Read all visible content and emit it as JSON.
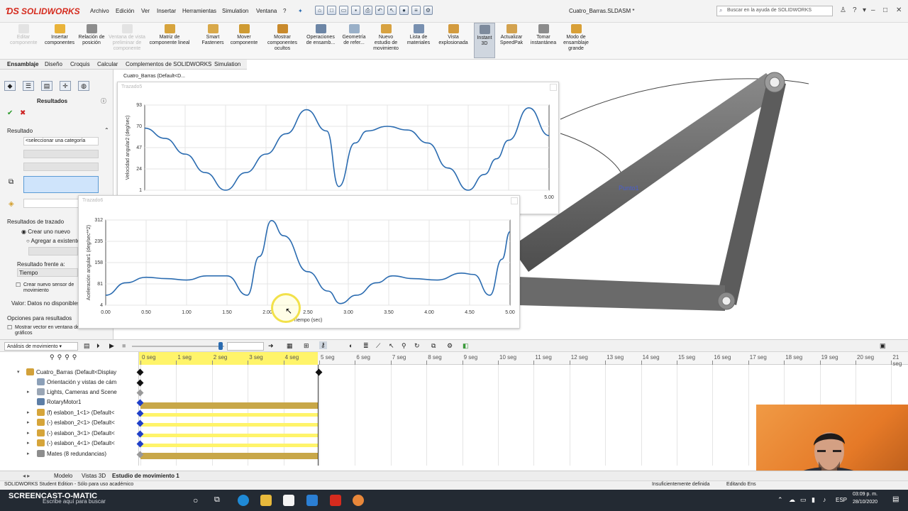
{
  "app": {
    "logo": "SOLIDWORKS",
    "menus": [
      "Archivo",
      "Edición",
      "Ver",
      "Insertar",
      "Herramientas",
      "Simulation",
      "Ventana",
      "?"
    ],
    "document_title": "Cuatro_Barras.SLDASM *",
    "search_placeholder": "Buscar en la ayuda de SOLIDWORKS"
  },
  "command_manager": [
    {
      "label": "Editar componente",
      "enabled": false
    },
    {
      "label": "Insertar componentes",
      "enabled": true
    },
    {
      "label": "Relación de posición",
      "enabled": true
    },
    {
      "label": "Ventana de vista preliminar de componente",
      "enabled": false
    },
    {
      "label": "Matriz de componente lineal",
      "enabled": true
    },
    {
      "label": "Smart Fasteners",
      "enabled": true
    },
    {
      "label": "Mover componente",
      "enabled": true
    },
    {
      "label": "Mostrar componentes ocultos",
      "enabled": true
    },
    {
      "label": "Operaciones de ensamb...",
      "enabled": true
    },
    {
      "label": "Geometría de refer...",
      "enabled": true
    },
    {
      "label": "Nuevo estudio de movimiento",
      "enabled": true
    },
    {
      "label": "Lista de materiales",
      "enabled": true
    },
    {
      "label": "Vista explosionada",
      "enabled": true
    },
    {
      "label": "Instant 3D",
      "enabled": true,
      "active": true
    },
    {
      "label": "Actualizar SpeedPak",
      "enabled": true
    },
    {
      "label": "Tomar instantánea",
      "enabled": true
    },
    {
      "label": "Modo de ensamblaje grande",
      "enabled": true
    }
  ],
  "tabs": [
    "Ensamblaje",
    "Diseño",
    "Croquis",
    "Calcular",
    "Complementos de SOLIDWORKS",
    "Simulation"
  ],
  "feature_tree_header": "Cuatro_Barras (Default<D...",
  "property_manager": {
    "title": "Resultados",
    "section_result": "Resultado",
    "category_placeholder": "<seleccionar una categoría",
    "section_plot": "Resultados de trazado",
    "radio_new": "Crear uno nuevo",
    "radio_existing": "Agregar a existente",
    "plot_against_label": "Resultado frente a:",
    "plot_against_value": "Tiempo",
    "checkbox_sensor": "Crear nuevo sensor de movimiento",
    "value_label": "Valor: Datos no disponibles",
    "section_options": "Opciones para resultados",
    "checkbox_vector": "Mostrar vector en ventana de gráficos"
  },
  "viewport": {
    "point_label": "Punto1"
  },
  "plots": [
    {
      "window_title": "Trazado5",
      "chart_data": {
        "type": "line",
        "ylabel": "Velocidad angular2 (deg/sec)",
        "yticks": [
          1,
          24,
          47,
          70,
          93
        ],
        "ylim": [
          1,
          93
        ],
        "xlim": [
          0,
          5
        ],
        "xticks_visible": [
          "5.00"
        ],
        "series": [
          {
            "x": [
              0,
              0.25,
              0.5,
              0.75,
              1.0,
              1.25,
              1.5,
              1.75,
              2.0,
              2.25,
              2.4,
              2.6,
              2.75,
              3.0,
              3.25,
              3.5,
              3.75,
              4.0,
              4.2,
              4.35,
              4.5,
              4.75,
              5.0
            ],
            "y": [
              68,
              57,
              40,
              20,
              1,
              20,
              40,
              62,
              88,
              65,
              5,
              52,
              65,
              70,
              66,
              52,
              25,
              1,
              18,
              35,
              55,
              90,
              60
            ]
          }
        ]
      }
    },
    {
      "window_title": "Trazado6",
      "chart_data": {
        "type": "line",
        "xlabel": "Tiempo (sec)",
        "ylabel": "Aceleración angular1 (deg/sec**2)",
        "yticks": [
          4,
          81,
          158,
          235,
          312
        ],
        "ylim": [
          4,
          312
        ],
        "xlim": [
          0,
          5
        ],
        "xticks": [
          "0.00",
          "0.50",
          "1.00",
          "1.50",
          "2.00",
          "2.50",
          "3.00",
          "3.50",
          "4.00",
          "4.50",
          "5.00"
        ],
        "series": [
          {
            "x": [
              0,
              0.25,
              0.5,
              0.75,
              1.0,
              1.25,
              1.5,
              1.75,
              1.9,
              2.05,
              2.2,
              2.5,
              2.75,
              2.9,
              3.1,
              3.35,
              3.55,
              3.8,
              4.1,
              4.4,
              4.55,
              4.75,
              4.9,
              5.0
            ],
            "y": [
              40,
              85,
              105,
              100,
              95,
              110,
              110,
              40,
              180,
              310,
              255,
              125,
              55,
              10,
              40,
              85,
              110,
              100,
              95,
              120,
              115,
              40,
              170,
              270
            ]
          }
        ]
      }
    }
  ],
  "motion_study": {
    "study_type": "Análisis de movimiento",
    "time_markers": [
      "0 seg",
      "1 seg",
      "2 seg",
      "3 seg",
      "4 seg",
      "5 seg",
      "6 seg",
      "7 seg",
      "8 seg",
      "9 seg",
      "10 seg",
      "11 seg",
      "12 seg",
      "13 seg",
      "14 seg",
      "15 seg",
      "16 seg",
      "17 seg",
      "18 seg",
      "19 seg",
      "20 seg",
      "21 seg"
    ],
    "tree": [
      {
        "label": "Cuatro_Barras (Default<Display",
        "bar": "none"
      },
      {
        "label": "Orientación y vistas de cám",
        "bar": "none"
      },
      {
        "label": "Lights, Cameras and Scene",
        "bar": "none"
      },
      {
        "label": "RotaryMotor1",
        "bar": "gold"
      },
      {
        "label": "(f) eslabon_1<1> (Default<",
        "bar": "yellow"
      },
      {
        "label": "(-) eslabon_2<1> (Default<",
        "bar": "yellow"
      },
      {
        "label": "(-) eslabon_3<1> (Default<",
        "bar": "yellow"
      },
      {
        "label": "(-) eslabon_4<1> (Default<",
        "bar": "yellow"
      },
      {
        "label": "Mates (8 redundancias)",
        "bar": "gold"
      }
    ],
    "bottom_tabs": [
      "Modelo",
      "Vistas 3D",
      "Estudio de movimiento 1"
    ]
  },
  "status": {
    "left": "SOLIDWORKS Student Edition - Sólo para uso académico",
    "state": "Insuficientemente definida",
    "mode": "Editando Ens"
  },
  "taskbar": {
    "search_placeholder": "Escribe aquí para buscar",
    "language": "ESP",
    "time": "03:09 p. m.",
    "date": "28/10/2020",
    "watermark": "SCREENCAST-O-MATIC"
  },
  "colors": {
    "accent_red": "#d52b1e",
    "plot_line": "#2a6bb0",
    "timeline_yellow": "#fff46a",
    "timeline_gold": "#c8a748",
    "link_gray": "#6b6b6b"
  }
}
